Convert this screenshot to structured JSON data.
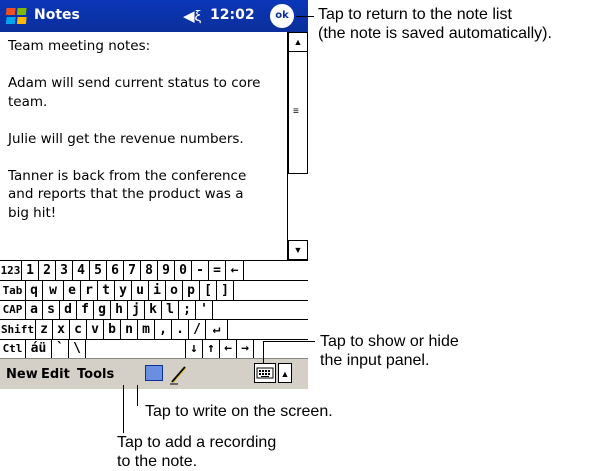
{
  "titlebar": {
    "app_title": "Notes",
    "time": "12:02",
    "ok_label": "ok",
    "speaker_icon": "speaker-icon",
    "start_icon": "windows-flag-icon"
  },
  "note": {
    "lines": [
      "Team meeting notes:",
      "",
      "Adam will send current status to core",
      "team.",
      "",
      "Julie will get the revenue numbers.",
      "",
      "Tanner is back from the conference",
      "and reports that the product was a",
      "big hit!"
    ]
  },
  "keyboard": {
    "rows": [
      [
        "123",
        "1",
        "2",
        "3",
        "4",
        "5",
        "6",
        "7",
        "8",
        "9",
        "0",
        "-",
        "=",
        "←"
      ],
      [
        "Tab",
        "q",
        "w",
        "e",
        "r",
        "t",
        "y",
        "u",
        "i",
        "o",
        "p",
        "[",
        "]"
      ],
      [
        "CAP",
        "a",
        "s",
        "d",
        "f",
        "g",
        "h",
        "j",
        "k",
        "l",
        ";",
        "'"
      ],
      [
        "Shift",
        "z",
        "x",
        "c",
        "v",
        "b",
        "n",
        "m",
        ",",
        ".",
        "/",
        "↵"
      ],
      [
        "Ctl",
        "áü",
        "`",
        "\\",
        "",
        "↓",
        "↑",
        "←",
        "→"
      ]
    ]
  },
  "cmdbar": {
    "menus": [
      "New",
      "Edit",
      "Tools"
    ],
    "record_icon": "recording-icon",
    "pen_icon": "pen-icon",
    "keyboard_icon": "keyboard-icon"
  },
  "callouts": {
    "ok": [
      "Tap to return to the note list",
      "(the note is saved automatically)."
    ],
    "input_panel": [
      "Tap to show or hide",
      "the input panel."
    ],
    "write": [
      "Tap to write on the screen."
    ],
    "recording": [
      "Tap to add a recording",
      "to the note."
    ]
  }
}
